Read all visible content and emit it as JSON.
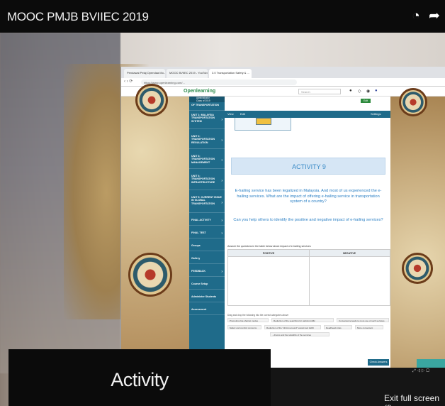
{
  "video": {
    "title": "MOOC PMJB BVIIEC 2019",
    "caption": "Activity",
    "exit_fullscreen": "Exit full screen (f)",
    "icons": [
      "clock-icon",
      "share-icon"
    ]
  },
  "browser": {
    "tabs": [
      "Pendawai Pelaj Opendaa Mo...",
      "MOOC BVIIEC 2019 - YouTube",
      "3.0 Transportation Safety & ..."
    ],
    "url": "https://www.openlearning.com/..."
  },
  "openlearning": {
    "logo": "Openlearning",
    "search_placeholder": "Search",
    "edit_label": "Edit",
    "course_label": "Administrator",
    "course_sub": "Class of 2019",
    "section_header": "OF TRANSPORTATION",
    "toolbar": {
      "view": "View",
      "edit": "Edit",
      "settings": "Settings"
    }
  },
  "sidebar": {
    "items": [
      {
        "label": "UNIT 1: MALAYSIA TRANSPORTATION SYSTEM"
      },
      {
        "label": "UNIT 2: TRANSPORTATION REGULATION"
      },
      {
        "label": "UNIT 3: TRANSPORTATION MANAGEMENT"
      },
      {
        "label": "UNIT 4: TRANSPORTATION INFRASTRUCTURE"
      },
      {
        "label": "UNIT 5: CURRENT ISSUE IN GLOBAL TRANSPORTATION"
      },
      {
        "label": "FINAL ACTIVITY"
      },
      {
        "label": "FINAL TEST"
      },
      {
        "label": "Groups"
      },
      {
        "label": "Gallery"
      },
      {
        "label": "FEEDBACK"
      },
      {
        "label": "Course Setup"
      },
      {
        "label": "Administer Students"
      },
      {
        "label": "Assessment"
      }
    ]
  },
  "activity": {
    "heading": "ACTIVITY 9",
    "paragraph1": "E-hailing service has been legalized in Malaysia. And most of us experienced the e-hailing services. What are the impact of offering e-hailing service in transportation system of a country?",
    "paragraph2": "Can you help others to identify the positive and negative impact of e-hailing services?",
    "instruction": "Answer the questions in the table below about impact of e-hailing services",
    "table_headers": [
      "POSITIVE",
      "NEGATIVE"
    ],
    "drag_note": "Drag and drop the following into the correct categories above",
    "chips": [
      "Promoting ride sharing modes",
      "Reduction of the searching for parking traffic",
      "Convenience leads to more use of such services",
      "Safety and comfort concerns",
      "Reduction of the \"driving around\" vacant taxi traffic",
      "Deadhead miles",
      "More convenient",
      "...drivers and the reliability of the services"
    ],
    "check_button": "Check Answers"
  }
}
